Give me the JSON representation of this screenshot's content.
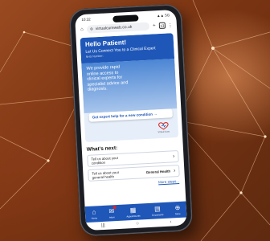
{
  "browser": {
    "time": "10:32",
    "signal": "▲▲ 5G",
    "url": "virtualcureweb.co.uk",
    "tab_count": "13"
  },
  "hero": {
    "title": "Hello Patient!",
    "subtitle": "Let Us Connect You to a Clinical Expert",
    "small": "NHS Number:",
    "body_lines": [
      "We provide rapid",
      "online access to",
      "clinical experts for",
      "specialist advice and",
      "diagnosis."
    ],
    "cta_label": "Get expert help for a new condition →",
    "logo_text": "Virtual Cure"
  },
  "whats_next": {
    "title": "What's next:",
    "items": [
      {
        "label_1": "Tell us about your",
        "label_2": "condition",
        "extra": ""
      },
      {
        "label_1": "Tell us about your",
        "label_2": "general health",
        "extra": "General Health"
      }
    ],
    "more_label": "More steps..."
  },
  "bottom_nav": {
    "items": [
      {
        "icon": "home-icon",
        "label": "Home"
      },
      {
        "icon": "inbox-icon",
        "label": "Inbox"
      },
      {
        "icon": "appointments-icon",
        "label": "Appointments"
      },
      {
        "icon": "documents-icon",
        "label": "Documents"
      },
      {
        "icon": "more-icon",
        "label": "More"
      }
    ]
  },
  "colors": {
    "brand": "#1f57b8",
    "background": "#7a3412"
  }
}
